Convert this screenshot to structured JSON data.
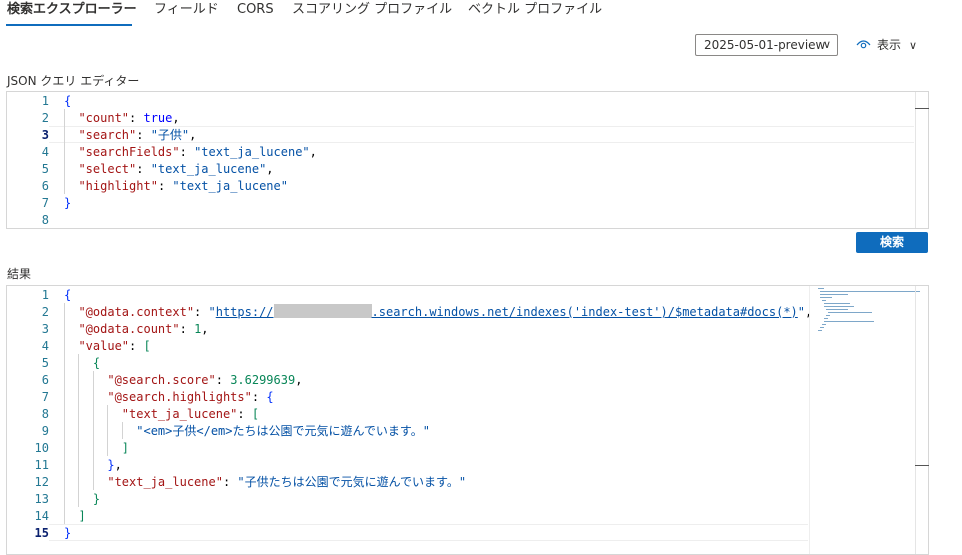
{
  "tabs": [
    {
      "label": "検索エクスプローラー",
      "active": true
    },
    {
      "label": "フィールド"
    },
    {
      "label": "CORS"
    },
    {
      "label": "スコアリング プロファイル"
    },
    {
      "label": "ベクトル プロファイル"
    }
  ],
  "api_version": {
    "selected": "2025-05-01-preview"
  },
  "view_toggle": {
    "label": "表示"
  },
  "query_editor": {
    "label": "JSON クエリ エディター",
    "active_line": 3,
    "lines": [
      {
        "n": "1",
        "parts": [
          {
            "t": "{",
            "c": "b"
          }
        ]
      },
      {
        "n": "2",
        "parts": [
          {
            "t": "  "
          },
          {
            "t": "\"count\"",
            "c": "k"
          },
          {
            "t": ": ",
            "c": "p"
          },
          {
            "t": "true",
            "c": "kw"
          },
          {
            "t": ",",
            "c": "p"
          }
        ]
      },
      {
        "n": "3",
        "parts": [
          {
            "t": "  "
          },
          {
            "t": "\"search\"",
            "c": "k"
          },
          {
            "t": ": ",
            "c": "p"
          },
          {
            "t": "\"子供\"",
            "c": "s"
          },
          {
            "t": ",",
            "c": "p"
          }
        ]
      },
      {
        "n": "4",
        "parts": [
          {
            "t": "  "
          },
          {
            "t": "\"searchFields\"",
            "c": "k"
          },
          {
            "t": ": ",
            "c": "p"
          },
          {
            "t": "\"text_ja_lucene\"",
            "c": "s"
          },
          {
            "t": ",",
            "c": "p"
          }
        ]
      },
      {
        "n": "5",
        "parts": [
          {
            "t": "  "
          },
          {
            "t": "\"select\"",
            "c": "k"
          },
          {
            "t": ": ",
            "c": "p"
          },
          {
            "t": "\"text_ja_lucene\"",
            "c": "s"
          },
          {
            "t": ",",
            "c": "p"
          }
        ]
      },
      {
        "n": "6",
        "parts": [
          {
            "t": "  "
          },
          {
            "t": "\"highlight\"",
            "c": "k"
          },
          {
            "t": ": ",
            "c": "p"
          },
          {
            "t": "\"text_ja_lucene\"",
            "c": "s"
          }
        ]
      },
      {
        "n": "7",
        "parts": [
          {
            "t": "}",
            "c": "b"
          }
        ]
      },
      {
        "n": "8",
        "parts": []
      }
    ]
  },
  "search_button": {
    "label": "検索"
  },
  "results": {
    "label": "結果",
    "active_line": 15,
    "lines": [
      {
        "n": "1",
        "parts": [
          {
            "t": "{",
            "c": "b"
          }
        ]
      },
      {
        "n": "2",
        "parts": [
          {
            "t": "  "
          },
          {
            "t": "\"@odata.context\"",
            "c": "k"
          },
          {
            "t": ": ",
            "c": "p"
          },
          {
            "t": "\"",
            "c": "s"
          },
          {
            "t": "https://",
            "c": "link"
          },
          {
            "t": "",
            "c": "redact"
          },
          {
            "t": ".search.windows.net/indexes('index-test')/$metadata#docs(*)",
            "c": "link"
          },
          {
            "t": "\"",
            "c": "s"
          },
          {
            "t": ",",
            "c": "p"
          }
        ]
      },
      {
        "n": "3",
        "parts": [
          {
            "t": "  "
          },
          {
            "t": "\"@odata.count\"",
            "c": "k"
          },
          {
            "t": ": ",
            "c": "p"
          },
          {
            "t": "1",
            "c": "n"
          },
          {
            "t": ",",
            "c": "p"
          }
        ]
      },
      {
        "n": "4",
        "parts": [
          {
            "t": "  "
          },
          {
            "t": "\"value\"",
            "c": "k"
          },
          {
            "t": ": ",
            "c": "p"
          },
          {
            "t": "[",
            "c": "n"
          }
        ]
      },
      {
        "n": "5",
        "parts": [
          {
            "t": "    "
          },
          {
            "t": "{",
            "c": "n"
          }
        ]
      },
      {
        "n": "6",
        "parts": [
          {
            "t": "      "
          },
          {
            "t": "\"@search.score\"",
            "c": "k"
          },
          {
            "t": ": ",
            "c": "p"
          },
          {
            "t": "3.6299639",
            "c": "n"
          },
          {
            "t": ",",
            "c": "p"
          }
        ]
      },
      {
        "n": "7",
        "parts": [
          {
            "t": "      "
          },
          {
            "t": "\"@search.highlights\"",
            "c": "k"
          },
          {
            "t": ": ",
            "c": "p"
          },
          {
            "t": "{",
            "c": "b"
          }
        ]
      },
      {
        "n": "8",
        "parts": [
          {
            "t": "        "
          },
          {
            "t": "\"text_ja_lucene\"",
            "c": "k"
          },
          {
            "t": ": ",
            "c": "p"
          },
          {
            "t": "[",
            "c": "n"
          }
        ]
      },
      {
        "n": "9",
        "parts": [
          {
            "t": "          "
          },
          {
            "t": "\"<em>子供</em>たちは公園で元気に遊んでいます。\"",
            "c": "s"
          }
        ]
      },
      {
        "n": "10",
        "parts": [
          {
            "t": "        "
          },
          {
            "t": "]",
            "c": "n"
          }
        ]
      },
      {
        "n": "11",
        "parts": [
          {
            "t": "      "
          },
          {
            "t": "}",
            "c": "b"
          },
          {
            "t": ",",
            "c": "p"
          }
        ]
      },
      {
        "n": "12",
        "parts": [
          {
            "t": "      "
          },
          {
            "t": "\"text_ja_lucene\"",
            "c": "k"
          },
          {
            "t": ": ",
            "c": "p"
          },
          {
            "t": "\"子供たちは公園で元気に遊んでいます。\"",
            "c": "s"
          }
        ]
      },
      {
        "n": "13",
        "parts": [
          {
            "t": "    "
          },
          {
            "t": "}",
            "c": "n"
          }
        ]
      },
      {
        "n": "14",
        "parts": [
          {
            "t": "  "
          },
          {
            "t": "]",
            "c": "n"
          }
        ]
      },
      {
        "n": "15",
        "parts": [
          {
            "t": "}",
            "c": "b"
          }
        ]
      }
    ]
  },
  "colors": {
    "accent": "#0f6cbd",
    "json_key": "#a31515",
    "json_string": "#0451a5",
    "json_number": "#098658"
  },
  "icons": {
    "view": "eye-icon",
    "dropdown": "chevron-down-icon"
  }
}
